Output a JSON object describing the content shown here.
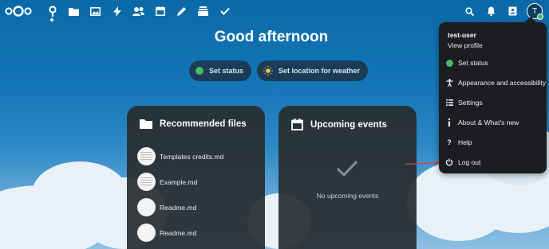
{
  "topbar": {
    "apps": [
      {
        "name": "dashboard",
        "icon": "dashboard-icon",
        "active": true
      },
      {
        "name": "files",
        "icon": "folder-icon"
      },
      {
        "name": "photos",
        "icon": "image-icon"
      },
      {
        "name": "activity",
        "icon": "lightning-icon"
      },
      {
        "name": "contacts",
        "icon": "contacts-icon"
      },
      {
        "name": "calendar",
        "icon": "calendar-icon"
      },
      {
        "name": "notes",
        "icon": "pencil-icon"
      },
      {
        "name": "deck",
        "icon": "stack-icon"
      },
      {
        "name": "tasks",
        "icon": "check-icon"
      }
    ],
    "avatar_initial": "T"
  },
  "greeting": "Good afternoon",
  "pills": {
    "set_status": "Set status",
    "set_location": "Set location for weather"
  },
  "recommended": {
    "title": "Recommended files",
    "files": [
      "Templates credits.md",
      "Example.md",
      "Readme.md",
      "Readme.md"
    ]
  },
  "events": {
    "title": "Upcoming events",
    "empty": "No upcoming events"
  },
  "menu": {
    "user": "test-user",
    "view_profile": "View profile",
    "items": [
      "Set status",
      "Appearance and accessibility",
      "Settings",
      "About & What's new",
      "Help",
      "Log out"
    ]
  },
  "colors": {
    "status_online": "#46ba61",
    "arrow": "#e53935",
    "panel_bg": "#282c30"
  }
}
